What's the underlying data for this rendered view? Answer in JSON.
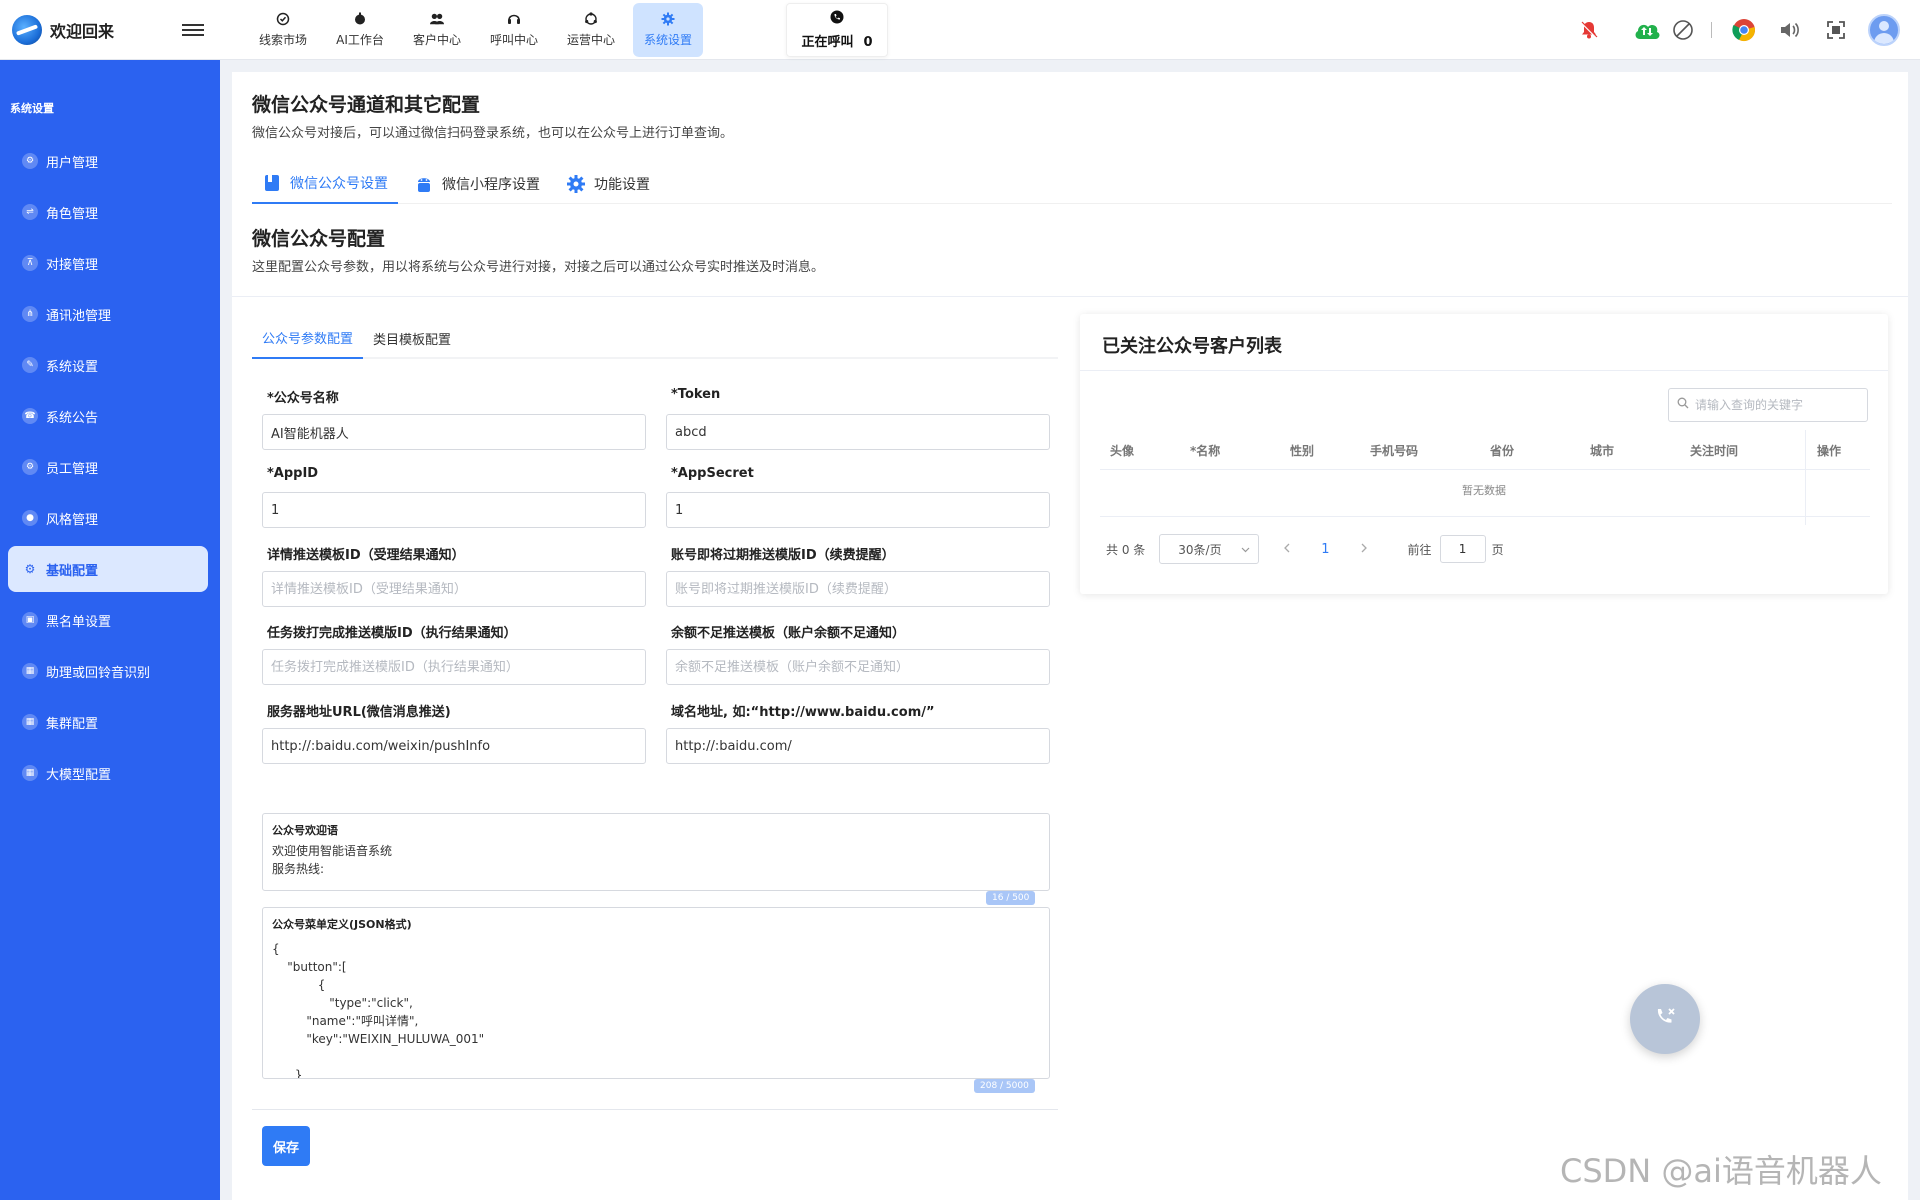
{
  "header": {
    "brand_title": "欢迎回来",
    "nav": [
      {
        "label": "线索市场",
        "icon": "clue-icon"
      },
      {
        "label": "AI工作台",
        "icon": "ai-icon"
      },
      {
        "label": "客户中心",
        "icon": "customers-icon"
      },
      {
        "label": "呼叫中心",
        "icon": "headset-icon"
      },
      {
        "label": "运营中心",
        "icon": "operations-icon"
      },
      {
        "label": "系统设置",
        "icon": "gear-icon",
        "active": true
      }
    ],
    "calling": {
      "label": "正在呼叫",
      "count": "0"
    }
  },
  "sidebar": {
    "section": "系统设置",
    "items": [
      {
        "label": "用户管理"
      },
      {
        "label": "角色管理"
      },
      {
        "label": "对接管理"
      },
      {
        "label": "通讯池管理"
      },
      {
        "label": "系统设置"
      },
      {
        "label": "系统公告"
      },
      {
        "label": "员工管理"
      },
      {
        "label": "风格管理"
      },
      {
        "label": "基础配置",
        "active": true
      },
      {
        "label": "黑名单设置"
      },
      {
        "label": "助理或回铃音识别"
      },
      {
        "label": "集群配置"
      },
      {
        "label": "大模型配置"
      }
    ]
  },
  "page": {
    "title": "微信公众号通道和其它配置",
    "desc": "微信公众号对接后，可以通过微信扫码登录系统，也可以在公众号上进行订单查询。",
    "tabs": [
      {
        "label": "微信公众号设置",
        "active": true
      },
      {
        "label": "微信小程序设置"
      },
      {
        "label": "功能设置"
      }
    ],
    "section_title": "微信公众号配置",
    "section_desc": "这里配置公众号参数，用以将系统与公众号进行对接，对接之后可以通过公众号实时推送及时消息。"
  },
  "form": {
    "tabs": [
      {
        "label": "公众号参数配置",
        "active": true
      },
      {
        "label": "类目模板配置"
      }
    ],
    "fields": {
      "name": {
        "label": "*公众号名称",
        "value": "AI智能机器人"
      },
      "token": {
        "label": "*Token",
        "value": "abcd"
      },
      "appid": {
        "label": "*AppID",
        "value": "1"
      },
      "appsecret": {
        "label": "*AppSecret",
        "value": "1"
      },
      "detail_tpl": {
        "label": "详情推送模板ID（受理结果通知）",
        "placeholder": "详情推送模板ID（受理结果通知）"
      },
      "expire_tpl": {
        "label": "账号即将过期推送模版ID（续费提醒）",
        "placeholder": "账号即将过期推送模版ID（续费提醒）"
      },
      "task_tpl": {
        "label": "任务拨打完成推送模版ID（执行结果通知）",
        "placeholder": "任务拨打完成推送模版ID（执行结果通知）"
      },
      "balance_tpl": {
        "label": "余额不足推送模板（账户余额不足通知）",
        "placeholder": "余额不足推送模板（账户余额不足通知）"
      },
      "server_url": {
        "label": "服务器地址URL(微信消息推送)",
        "value": "http://:baidu.com/weixin/pushInfo"
      },
      "domain": {
        "label": "域名地址, 如:“http://www.baidu.com/”",
        "value": "http://:baidu.com/"
      }
    },
    "welcome": {
      "label": "公众号欢迎语",
      "text": "欢迎使用智能语音系统\n服务热线:",
      "counter": "16 / 500"
    },
    "menu": {
      "label": "公众号菜单定义(JSON格式)",
      "text": "{\n    \"button\":[\n            {\n               \"type\":\"click\",\n         \"name\":\"呼叫详情\",\n         \"key\":\"WEIXIN_HULUWA_001\"\n\n      }",
      "counter": "208 / 5000"
    },
    "save_label": "保存"
  },
  "followers": {
    "title": "已关注公众号客户列表",
    "search_placeholder": "请输入查询的关键字",
    "columns": [
      "头像",
      "*名称",
      "性别",
      "手机号码",
      "省份",
      "城市",
      "关注时间",
      "操作"
    ],
    "empty_text": "暂无数据",
    "pagination": {
      "total_text": "共 0 条",
      "page_size": "30条/页",
      "current_page": "1",
      "goto_label": "前往",
      "goto_value": "1",
      "page_suffix": "页"
    }
  },
  "watermark": "CSDN @ai语音机器人",
  "colors": {
    "accent": "#2f7bf5",
    "sidebar": "#2b62f0",
    "bell": "#e53935",
    "cloud": "#22b14c"
  }
}
